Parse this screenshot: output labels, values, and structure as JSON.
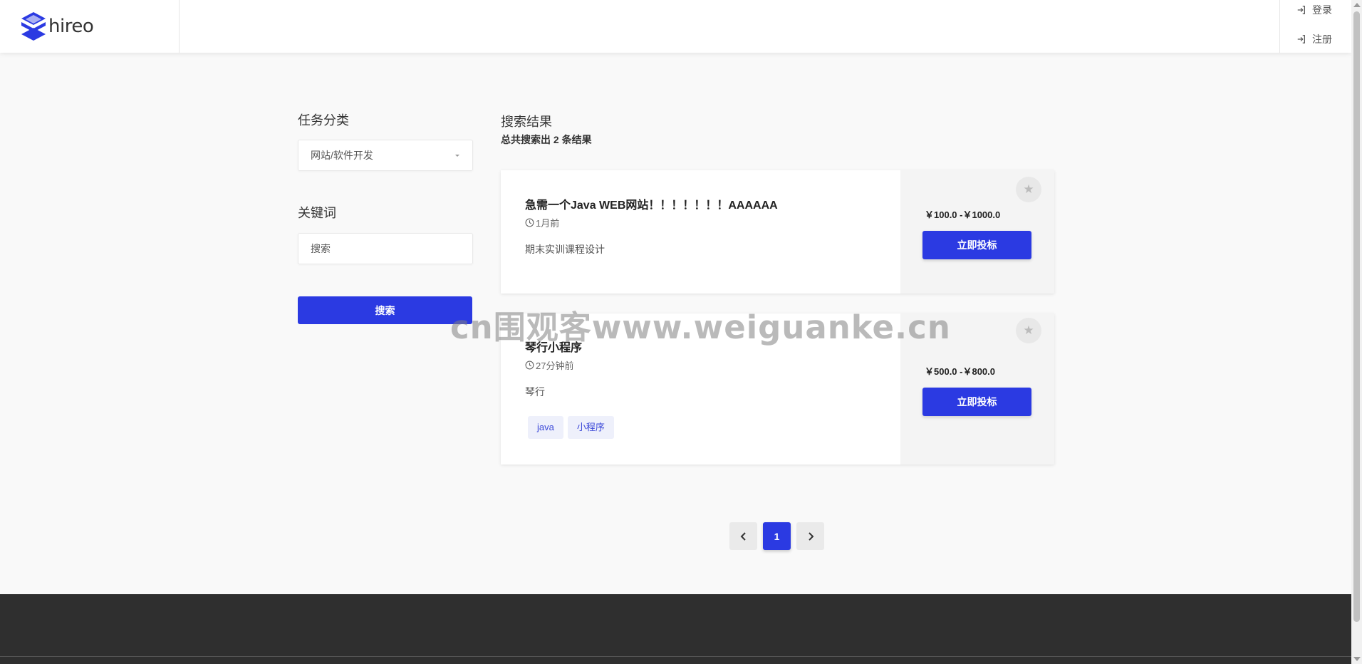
{
  "header": {
    "logo_text": "hireo",
    "auth": [
      {
        "label": "登录",
        "icon": "login-icon"
      },
      {
        "label": "注册",
        "icon": "login-icon"
      }
    ]
  },
  "sidebar": {
    "category_title": "任务分类",
    "category_selected": "网站/软件开发",
    "keyword_title": "关键词",
    "keyword_placeholder": "搜索",
    "search_button": "搜索"
  },
  "results": {
    "title": "搜索结果",
    "count_text": "总共搜索出 2 条结果",
    "cards": [
      {
        "title": "急需一个Java WEB网站！！！！！！！AAAAAA",
        "time": "1月前",
        "description": "期末实训课程设计",
        "tags": [],
        "price": "￥100.0 -￥1000.0",
        "bid_label": "立即投标"
      },
      {
        "title": "琴行小程序",
        "time": "27分钟前",
        "description": "琴行",
        "tags": [
          "java",
          "小程序"
        ],
        "price": "￥500.0 -￥800.0",
        "bid_label": "立即投标"
      }
    ]
  },
  "pagination": {
    "current_page": "1",
    "prev_icon": "chevron-left-icon",
    "next_icon": "chevron-right-icon"
  },
  "watermark": "cn围观客www.weiguanke.cn",
  "colors": {
    "accent": "#2b3ae2",
    "footer": "#2f2f2f",
    "tag_bg": "#eef0fb"
  }
}
